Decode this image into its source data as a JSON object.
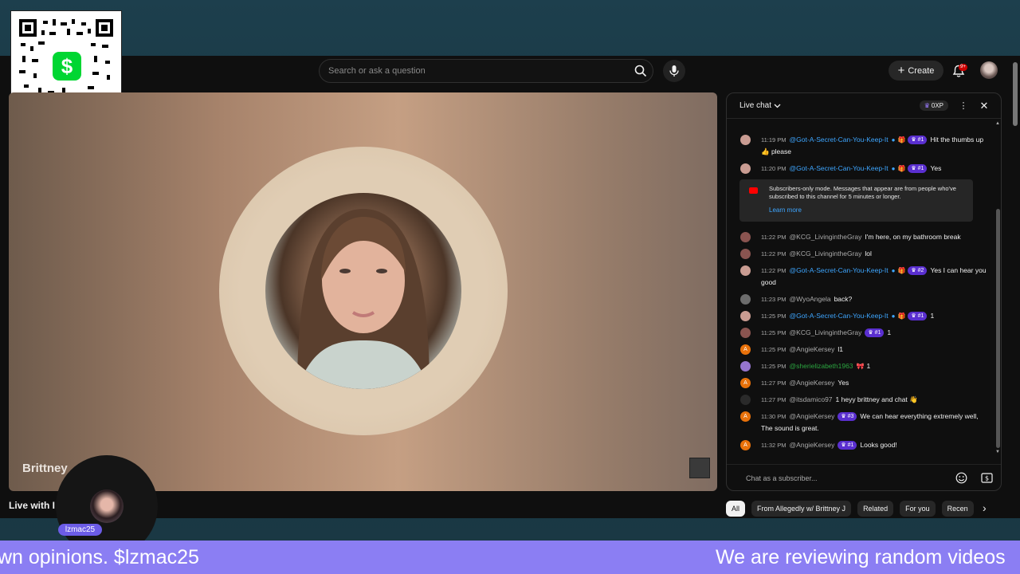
{
  "header": {
    "search_placeholder": "Search or ask a question",
    "create_label": "Create",
    "notifications_badge": "9+"
  },
  "qr": {
    "symbol": "$"
  },
  "video": {
    "name_overlay": "Brittney",
    "title": "Live with I"
  },
  "overlay": {
    "handle": "lzmac25"
  },
  "chat": {
    "title": "Live chat",
    "xp": "0XP",
    "menu": "⋮",
    "close": "✕",
    "messages": [
      {
        "time": "11:19 PM",
        "author": "@Got-A-Secret-Can-You-Keep-It",
        "badge": "#1",
        "text": "Hit the thumbs up 👍 please"
      },
      {
        "time": "11:20 PM",
        "author": "@Got-A-Secret-Can-You-Keep-It",
        "badge": "#1",
        "text": "Yes"
      },
      {
        "time": "11:22 PM",
        "author": "@KCG_LivingintheGray",
        "badge": "",
        "text": "I'm here, on my bathroom break"
      },
      {
        "time": "11:22 PM",
        "author": "@KCG_LivingintheGray",
        "badge": "",
        "text": "lol"
      },
      {
        "time": "11:22 PM",
        "author": "@Got-A-Secret-Can-You-Keep-It",
        "badge": "#2",
        "text": "Yes I can hear you good"
      },
      {
        "time": "11:23 PM",
        "author": "@WyoAngela",
        "badge": "",
        "text": "back?"
      },
      {
        "time": "11:25 PM",
        "author": "@Got-A-Secret-Can-You-Keep-It",
        "badge": "#1",
        "text": "1"
      },
      {
        "time": "11:25 PM",
        "author": "@KCG_LivingintheGray",
        "badge": "#1",
        "text": "1"
      },
      {
        "time": "11:25 PM",
        "author": "@AngieKersey",
        "badge": "",
        "text": "l1"
      },
      {
        "time": "11:25 PM",
        "author": "@sherielizabeth1963",
        "badge": "",
        "text": "1"
      },
      {
        "time": "11:27 PM",
        "author": "@AngieKersey",
        "badge": "",
        "text": "Yes"
      },
      {
        "time": "11:27 PM",
        "author": "@itsdamico97",
        "badge": "",
        "text": "1 heyy brittney and chat 👋"
      },
      {
        "time": "11:30 PM",
        "author": "@AngieKersey",
        "badge": "#3",
        "text": "We can hear everything extremely well, The sound is great."
      },
      {
        "time": "11:32 PM",
        "author": "@AngieKersey",
        "badge": "#1",
        "text": "Looks good!"
      }
    ],
    "notice": {
      "text": "Subscribers-only mode. Messages that appear are from people who've subscribed to this channel for 5 minutes or longer.",
      "link": "Learn more"
    },
    "input_placeholder": "Chat as a subscriber..."
  },
  "chips": [
    "All",
    "From Allegedly w/ Brittney J",
    "Related",
    "For you",
    "Recen"
  ],
  "ticker": {
    "left": "wn opinions. $lzmac25",
    "right": "We are reviewing random videos"
  },
  "colors": {
    "accent_purple": "#8b7ef3",
    "badge_purple": "#5a2fd0",
    "link_blue": "#3ea6ff",
    "cashapp_green": "#00d632"
  }
}
